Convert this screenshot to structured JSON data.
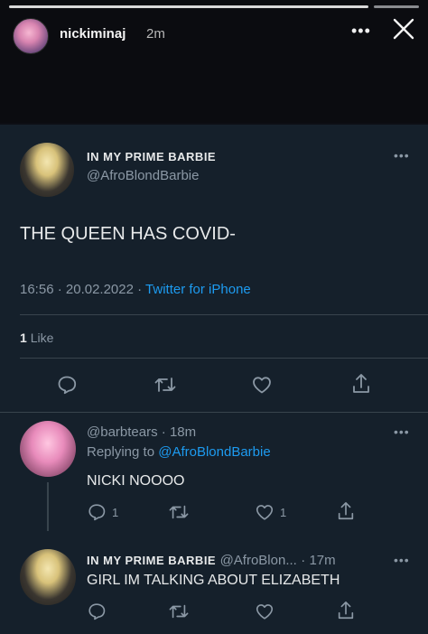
{
  "story": {
    "username": "nickiminaj",
    "time": "2m",
    "more": "•••"
  },
  "tweet": {
    "name": "IN MY PRIME BARBIE",
    "handle": "@AfroBlondBarbie",
    "text": "THE QUEEN HAS COVID-",
    "time": "16:56",
    "date": "20.02.2022",
    "source": "Twitter for iPhone",
    "likes_count": "1",
    "likes_label": "Like",
    "more": "•••"
  },
  "reply1": {
    "handle": "@barbtears",
    "time": "18m",
    "replying_prefix": "Replying to",
    "replying_to": "@AfroBlondBarbie",
    "text": "NICKI NOOOO",
    "reply_count": "1",
    "like_count": "1",
    "more": "•••"
  },
  "reply2": {
    "name": "IN MY PRIME BARBIE",
    "handle": "@AfroBlon...",
    "time": "17m",
    "text": "GIRL IM TALKING ABOUT ELIZABETH",
    "more": "•••"
  },
  "colors": {
    "background": "#15202b",
    "accent": "#1d9bf0",
    "muted": "#8b98a5"
  },
  "icons": [
    "close-icon",
    "reply-icon",
    "retweet-icon",
    "like-icon",
    "share-icon"
  ]
}
